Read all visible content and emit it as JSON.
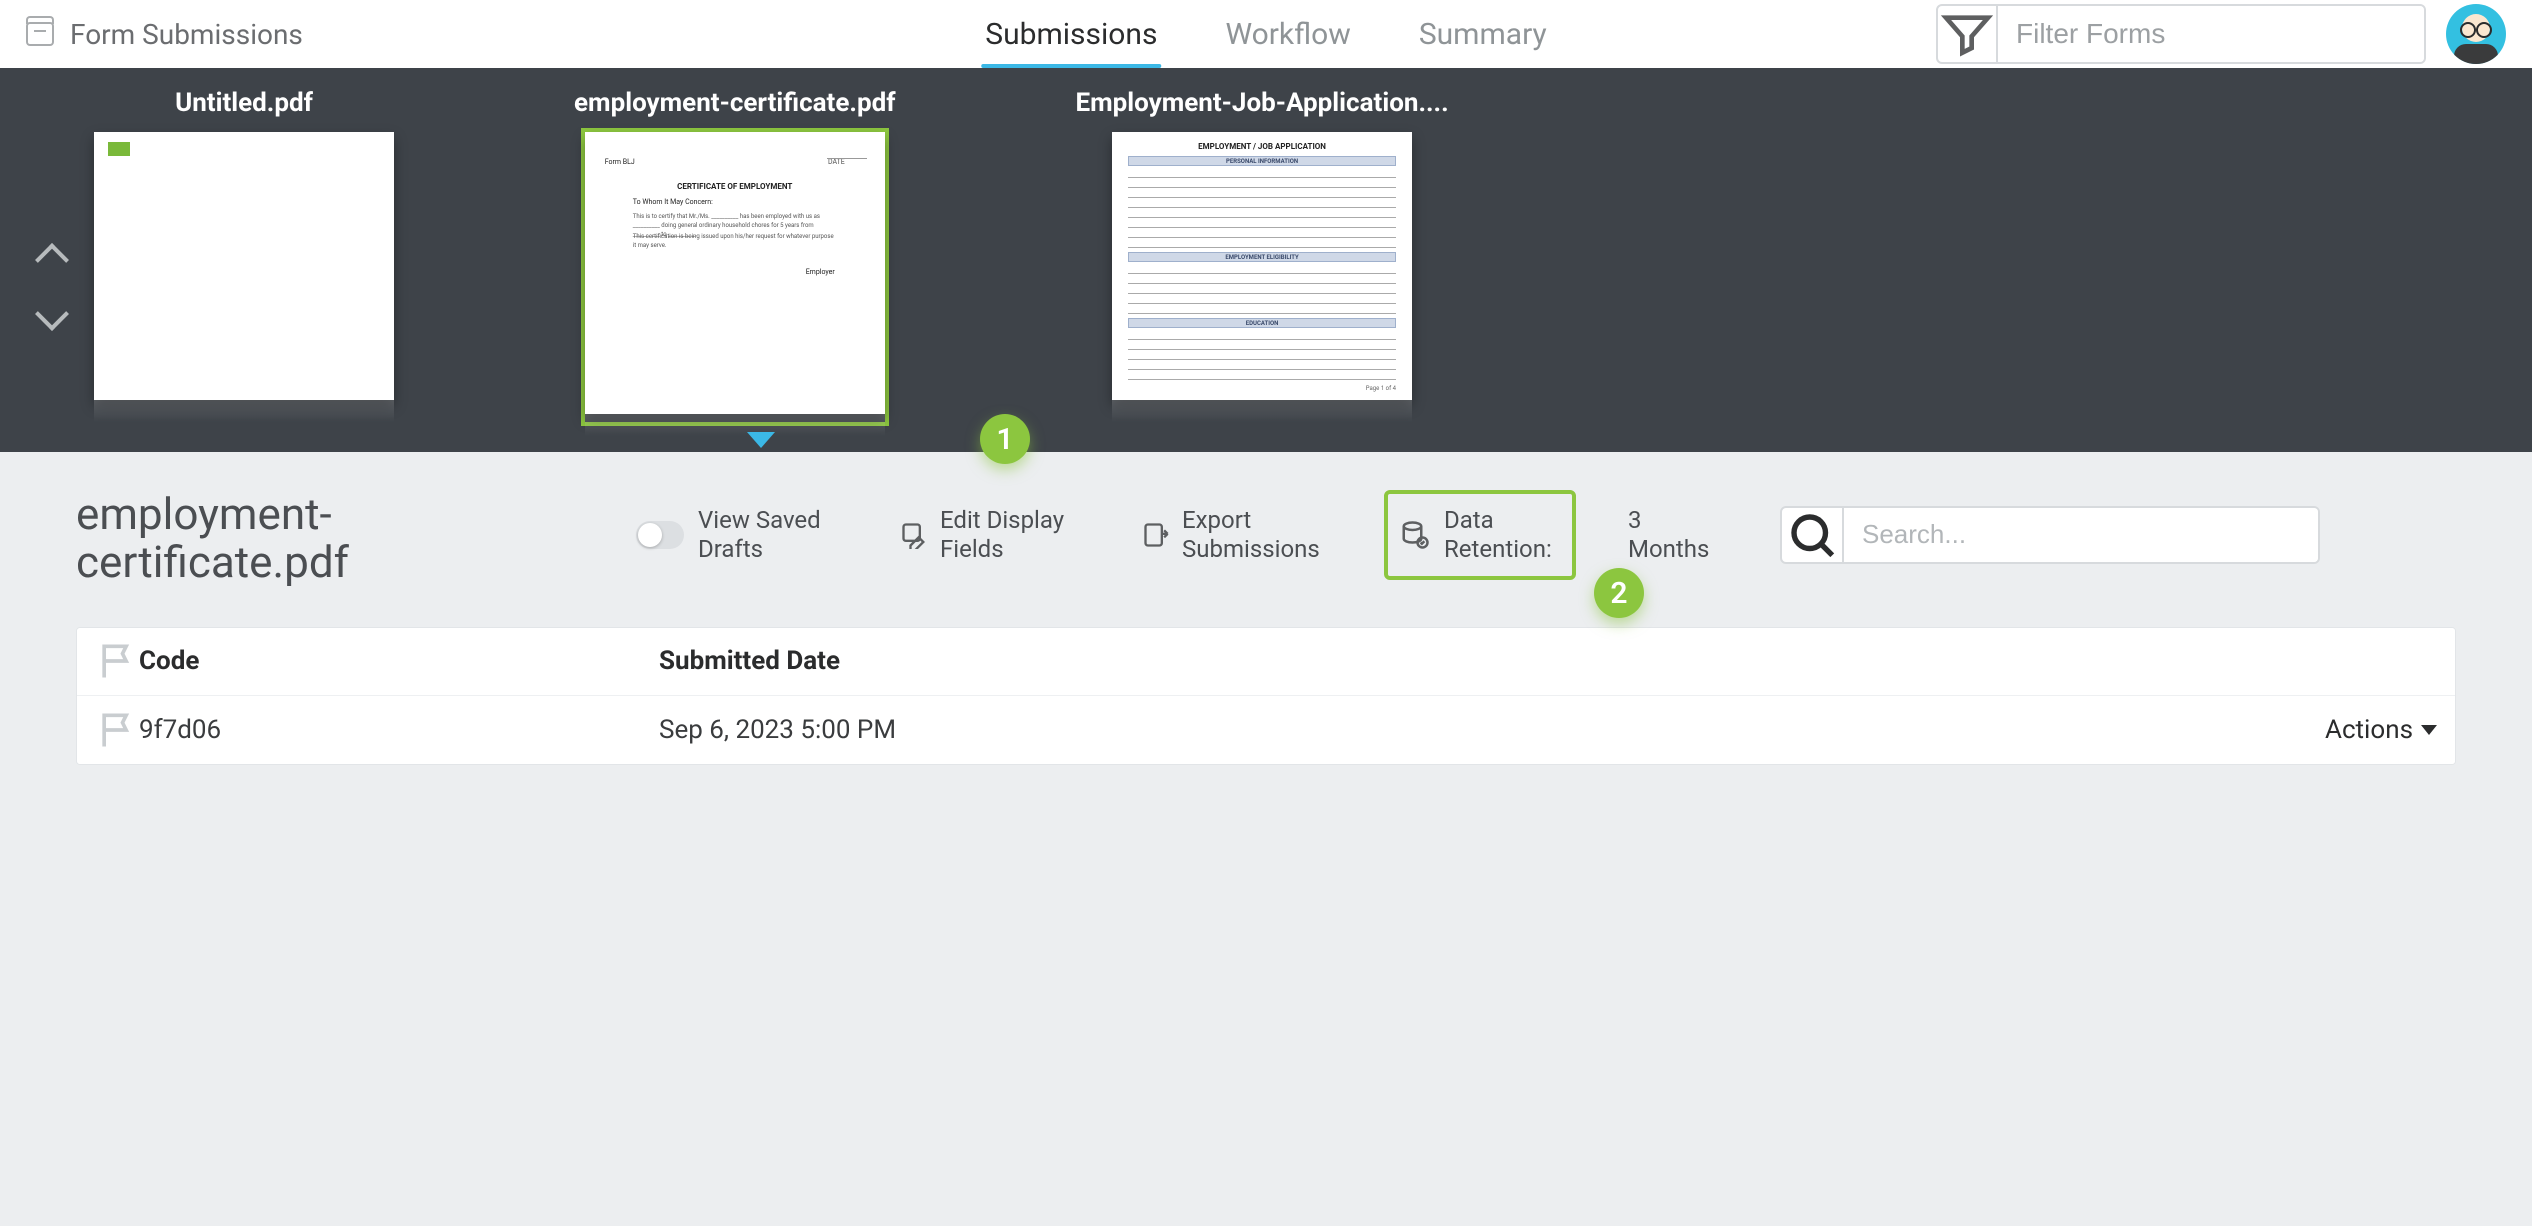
{
  "header": {
    "app_title": "Form Submissions",
    "tabs": [
      {
        "label": "Submissions",
        "active": true
      },
      {
        "label": "Workflow",
        "active": false
      },
      {
        "label": "Summary",
        "active": false
      }
    ],
    "filter_placeholder": "Filter Forms"
  },
  "forms": [
    {
      "title": "Untitled.pdf"
    },
    {
      "title": "employment-certificate.pdf"
    },
    {
      "title": "Employment-Job-Application...."
    }
  ],
  "selected_form_index": 1,
  "callouts": {
    "one": "1",
    "two": "2"
  },
  "main": {
    "title": "employment-certificate.pdf",
    "view_saved_drafts": "View Saved Drafts",
    "edit_display_fields": "Edit Display Fields",
    "export_submissions": "Export Submissions",
    "data_retention_label": "Data Retention:",
    "data_retention_value": "3 Months",
    "search_placeholder": "Search..."
  },
  "table": {
    "columns": {
      "code": "Code",
      "submitted": "Submitted Date",
      "actions": "Actions"
    },
    "rows": [
      {
        "code": "9f7d06",
        "submitted": "Sep 6, 2023 5:00 PM"
      }
    ]
  },
  "cert_doc": {
    "form_no": "Form BLJ",
    "date_label": "DATE",
    "title": "CERTIFICATE OF EMPLOYMENT",
    "towhom": "To Whom It May Concern:",
    "p1": "This is to certify that Mr./Ms. __________ has been employed with us as __________ doing general ordinary household chores for 5 years from __________ to __________.",
    "p2": "This certification is being issued upon his/her request for whatever purpose it may serve.",
    "sign": "Employer"
  },
  "app_doc": {
    "title": "EMPLOYMENT / JOB APPLICATION",
    "s1": "PERSONAL INFORMATION",
    "s2": "EMPLOYMENT ELIGIBILITY",
    "s3": "EDUCATION",
    "page": "Page 1 of 4"
  }
}
